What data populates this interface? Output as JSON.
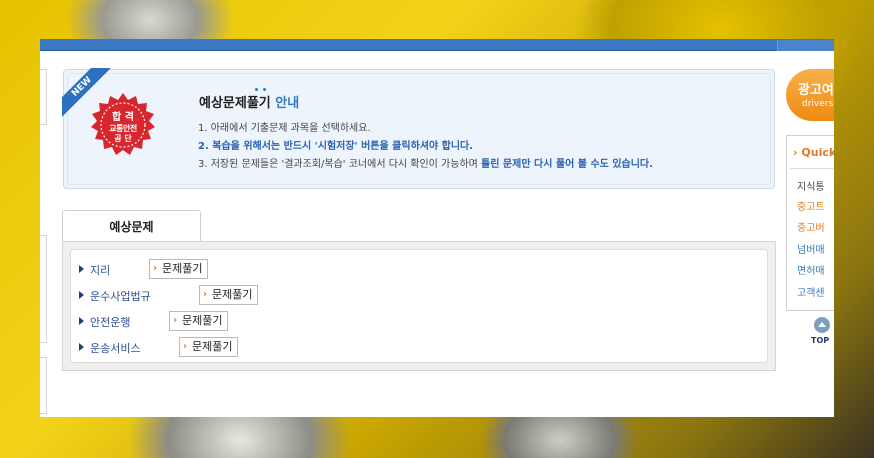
{
  "notice": {
    "ribbon": "NEW",
    "seal": {
      "line1": "합 격",
      "line2": "교통안전",
      "line3": "공 단"
    },
    "title_main": "예상문제풀기",
    "title_highlight": "안내",
    "line1": "1. 아래에서 기출문제 과목을 선택하세요.",
    "line2": "2. 복습을 위해서는 반드시 '시험저장' 버튼을 클릭하셔야 합니다.",
    "line3_prefix": "3. 저장된 문제들은 '결과조회/복습' 코너에서 다시 확인이 가능하며",
    "line3_bold": "틀린 문제만 다시 풀어 볼 수도 있습니다."
  },
  "tabs": {
    "active_label": "예상문제"
  },
  "subjects": [
    {
      "name": "지리",
      "button": "문제풀기"
    },
    {
      "name": "운수사업법규",
      "button": "문제풀기"
    },
    {
      "name": "안전운행",
      "button": "문제풀기"
    },
    {
      "name": "운송서비스",
      "button": "문제풀기"
    }
  ],
  "side": {
    "ad_line1": "광고여",
    "ad_line2": "drivers",
    "quick_title": "Quick",
    "quick_items": [
      {
        "label": "지식통",
        "color": "#444444"
      },
      {
        "label": "중고트",
        "color": "#e07a22"
      },
      {
        "label": "중고버",
        "color": "#e07a22"
      },
      {
        "label": "넘버매",
        "color": "#3a7bbf"
      },
      {
        "label": "면허매",
        "color": "#3a7bbf"
      },
      {
        "label": "고객센",
        "color": "#3a7bbf"
      }
    ],
    "top_label": "TOP"
  },
  "colors": {
    "accent_blue": "#3d78c4",
    "accent_orange": "#e07a22",
    "seal_red": "#d8262f"
  }
}
